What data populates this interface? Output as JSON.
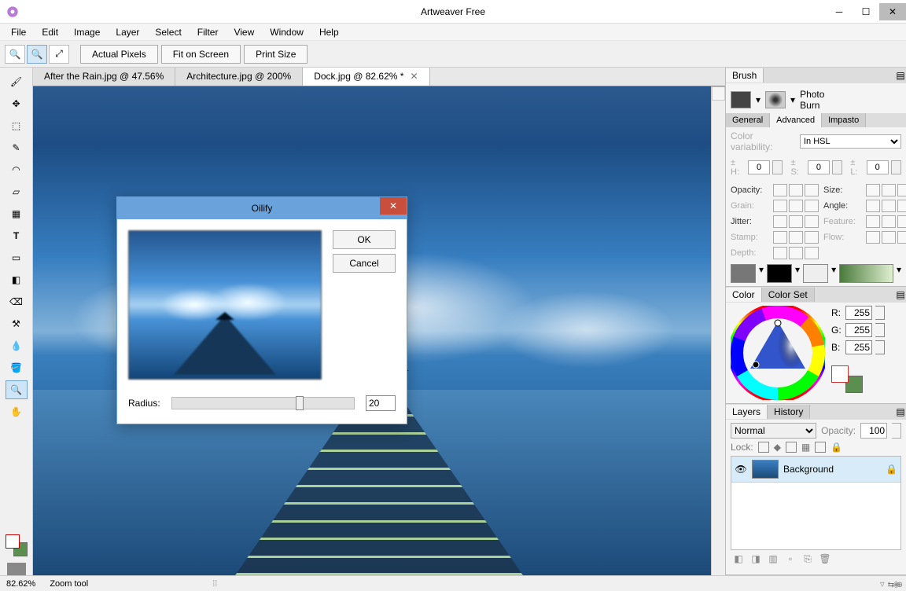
{
  "app": {
    "title": "Artweaver Free"
  },
  "menu": [
    "File",
    "Edit",
    "Image",
    "Layer",
    "Select",
    "Filter",
    "View",
    "Window",
    "Help"
  ],
  "toolbar": {
    "actual_pixels": "Actual Pixels",
    "fit_screen": "Fit on Screen",
    "print_size": "Print Size"
  },
  "tabs": [
    {
      "label": "After the Rain.jpg @ 47.56%",
      "active": false
    },
    {
      "label": "Architecture.jpg @ 200%",
      "active": false
    },
    {
      "label": "Dock.jpg @ 82.62% *",
      "active": true
    }
  ],
  "dialog": {
    "title": "Oilify",
    "ok": "OK",
    "cancel": "Cancel",
    "radius_label": "Radius:",
    "radius_value": "20"
  },
  "brush_panel": {
    "title": "Brush",
    "name1": "Photo",
    "name2": "Burn",
    "subtabs": [
      "General",
      "Advanced",
      "Impasto"
    ],
    "color_var_label": "Color variability:",
    "color_var_value": "In HSL",
    "hsl": {
      "h_label": "± H:",
      "h": "0",
      "s_label": "± S:",
      "s": "0",
      "l_label": "± L:",
      "l": "0"
    },
    "props": {
      "opacity": "Opacity:",
      "size": "Size:",
      "grain": "Grain:",
      "angle": "Angle:",
      "jitter": "Jitter:",
      "feature": "Feature:",
      "stamp": "Stamp:",
      "flow": "Flow:",
      "depth": "Depth:"
    }
  },
  "color_panel": {
    "tabs": [
      "Color",
      "Color Set"
    ],
    "r_label": "R:",
    "g_label": "G:",
    "b_label": "B:",
    "r": "255",
    "g": "255",
    "b": "255"
  },
  "layers_panel": {
    "tabs": [
      "Layers",
      "History"
    ],
    "blend_mode": "Normal",
    "opacity_label": "Opacity:",
    "opacity_value": "100",
    "lock_label": "Lock:",
    "layer_name": "Background"
  },
  "status": {
    "zoom": "82.62%",
    "tool": "Zoom tool"
  }
}
